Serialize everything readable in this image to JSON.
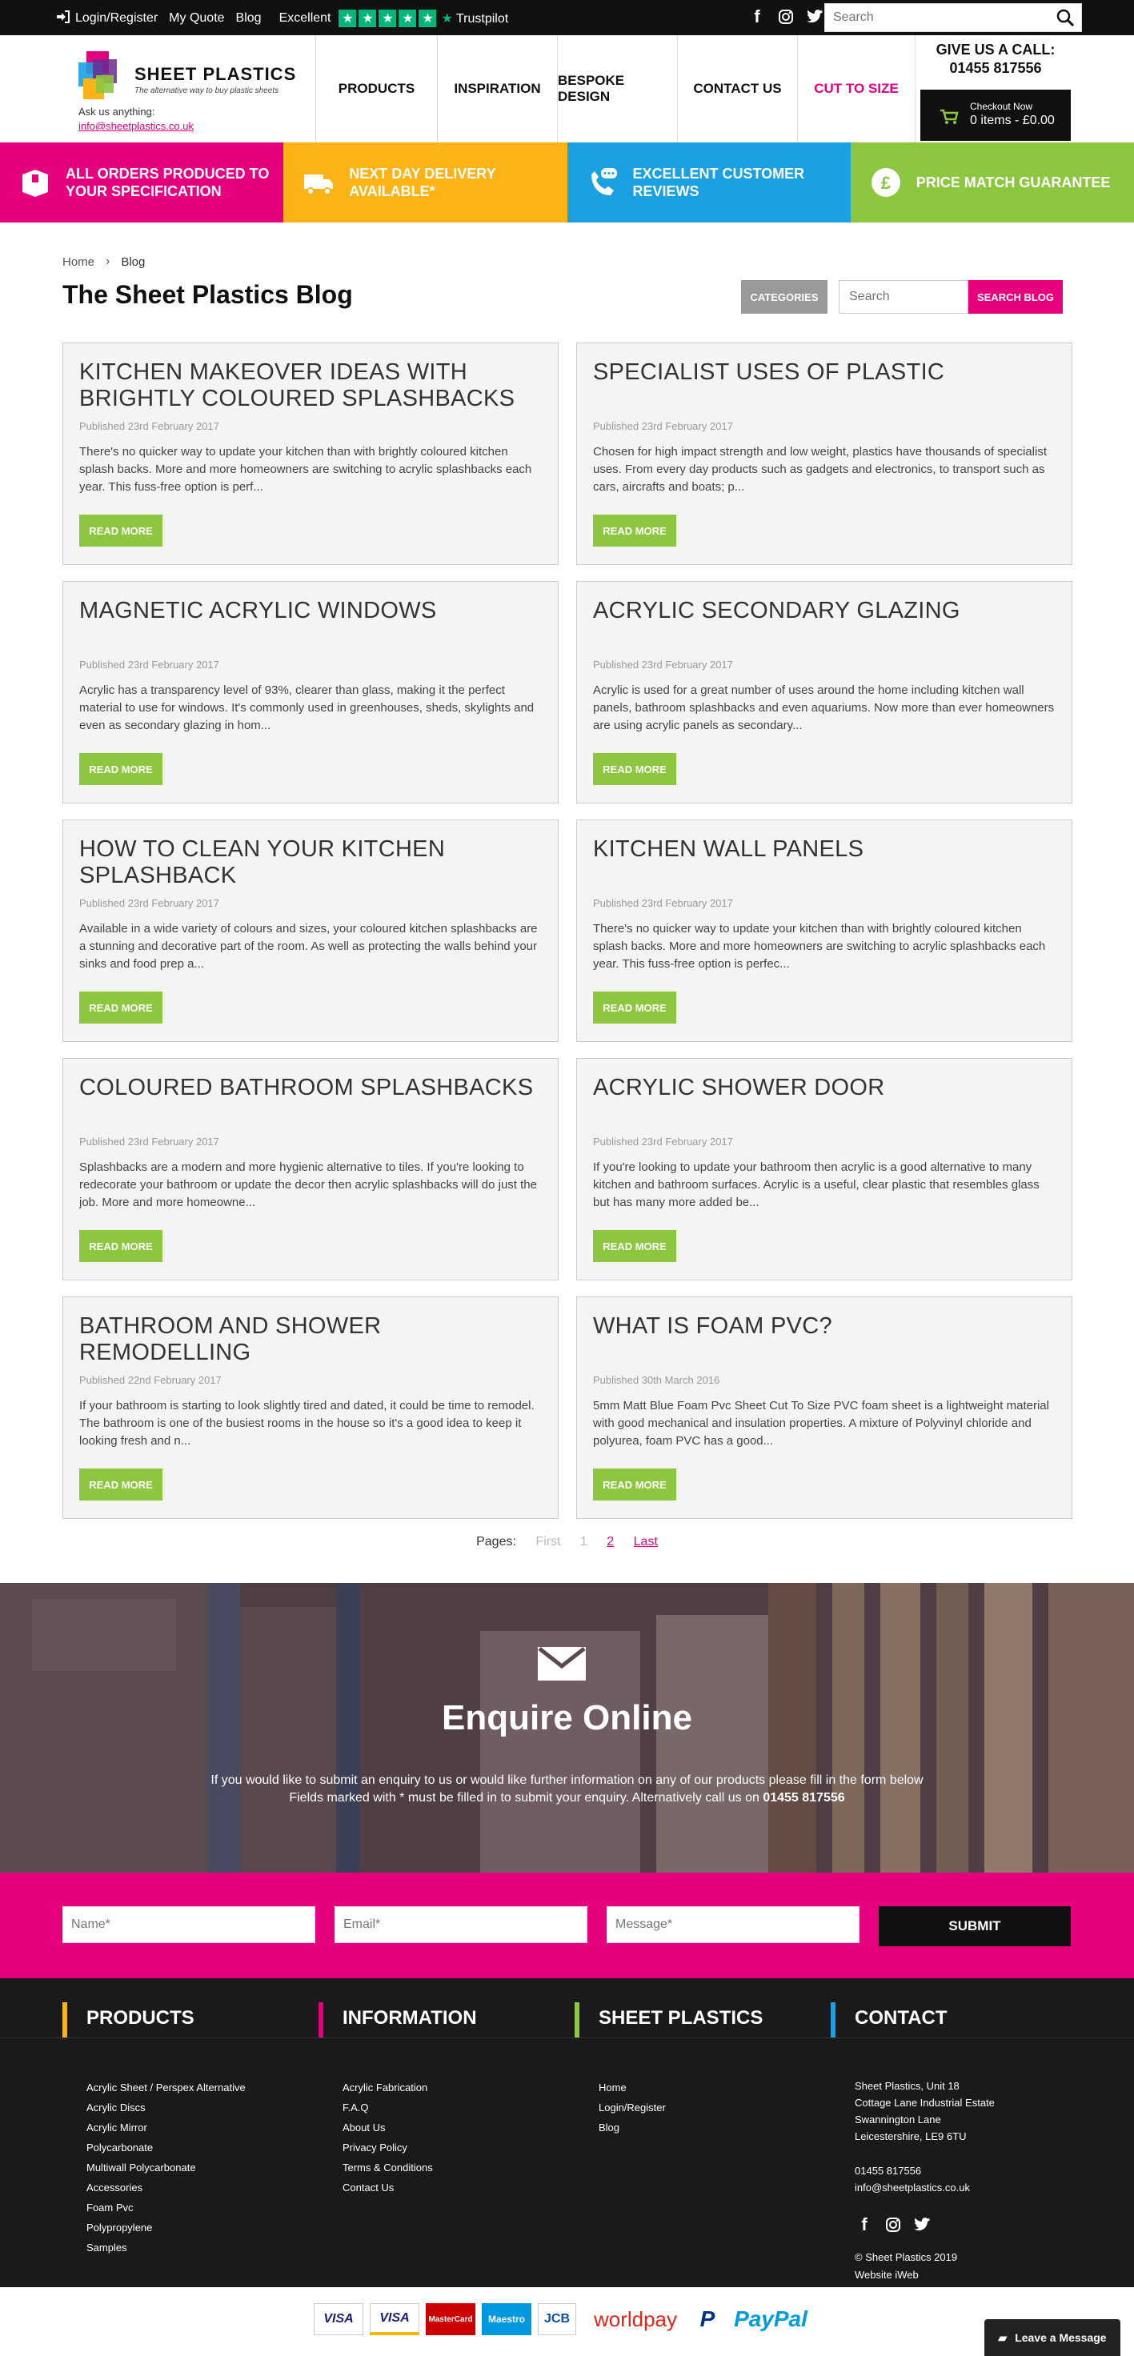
{
  "topbar": {
    "login_label": "Login/Register",
    "quote_label": "My Quote",
    "blog_label": "Blog",
    "rating_label": "Excellent",
    "trustpilot_label": "Trustpilot",
    "search_placeholder": "Search"
  },
  "header": {
    "brand_name": "SHEET PLASTICS",
    "brand_tagline": "The alternative way to buy plastic sheets",
    "ask_label": "Ask us anything:",
    "ask_email": "info@sheetplastics.co.uk",
    "nav": [
      {
        "label": "PRODUCTS"
      },
      {
        "label": "INSPIRATION"
      },
      {
        "label": "BESPOKE DESIGN"
      },
      {
        "label": "CONTACT US"
      },
      {
        "label": "CUT TO SIZE"
      }
    ],
    "call_label": "GIVE US A CALL:",
    "call_number": "01455 817556",
    "checkout_label": "Checkout Now",
    "checkout_summary": "0 items - £0.00"
  },
  "usp": [
    {
      "label": "ALL ORDERS PRODUCED TO YOUR SPECIFICATION",
      "color": "#e6007e",
      "icon": "box-icon"
    },
    {
      "label": "NEXT DAY DELIVERY AVAILABLE*",
      "color": "#fbb316",
      "icon": "truck-icon"
    },
    {
      "label": "EXCELLENT CUSTOMER REVIEWS",
      "color": "#1ba1e2",
      "icon": "phone-chat-icon"
    },
    {
      "label": "PRICE MATCH GUARANTEE",
      "color": "#8dc63f",
      "icon": "pound-icon"
    }
  ],
  "breadcrumb": {
    "home": "Home",
    "current": "Blog"
  },
  "blog": {
    "title": "The Sheet Plastics Blog",
    "categories_label": "CATEGORIES",
    "search_placeholder": "Search",
    "search_button": "SEARCH BLOG",
    "read_more": "READ MORE"
  },
  "posts": [
    {
      "title": "KITCHEN MAKEOVER IDEAS WITH BRIGHTLY COLOURED SPLASHBACKS",
      "date": "Published 23rd February 2017",
      "excerpt": "There's no quicker way to update your kitchen than with brightly coloured kitchen splash backs. More and more homeowners are switching to acrylic splashbacks each year. This fuss-free option is perf..."
    },
    {
      "title": "SPECIALIST USES OF PLASTIC",
      "date": "Published 23rd February 2017",
      "excerpt": "Chosen for high impact strength and low weight, plastics have thousands of specialist uses. From every day products such as gadgets and electronics, to transport such as cars, aircrafts and boats; p..."
    },
    {
      "title": "MAGNETIC ACRYLIC WINDOWS",
      "date": "Published 23rd February 2017",
      "excerpt": "Acrylic has a transparency level of 93%, clearer than glass, making it the perfect material to use for windows. It's commonly used in greenhouses, sheds, skylights and even as secondary glazing in hom..."
    },
    {
      "title": "ACRYLIC SECONDARY GLAZING",
      "date": "Published 23rd February 2017",
      "excerpt": "Acrylic is used for a great number of uses around the home including kitchen wall panels, bathroom splashbacks and even aquariums. Now more than ever homeowners are using acrylic panels as secondary..."
    },
    {
      "title": "HOW TO CLEAN YOUR KITCHEN SPLASHBACK",
      "date": "Published 23rd February 2017",
      "excerpt": "Available in a wide variety of colours and sizes, your coloured kitchen splashbacks are a stunning and decorative part of the room. As well as protecting the walls behind your sinks and food prep a..."
    },
    {
      "title": "KITCHEN WALL PANELS",
      "date": "Published 23rd February 2017",
      "excerpt": "There's no quicker way to update your kitchen than with brightly coloured kitchen splash backs. More and more homeowners are switching to acrylic splashbacks each year. This fuss-free option is perfec..."
    },
    {
      "title": "COLOURED BATHROOM SPLASHBACKS",
      "date": "Published 23rd February 2017",
      "excerpt": "Splashbacks are a modern and more hygienic alternative to tiles. If you're looking to redecorate your bathroom or update the decor then acrylic splashbacks will do just the job. More and more homeowne..."
    },
    {
      "title": "ACRYLIC SHOWER DOOR",
      "date": "Published 23rd February 2017",
      "excerpt": "If you're looking to update your bathroom then acrylic is a good alternative to many kitchen and bathroom surfaces. Acrylic is a useful, clear plastic that resembles glass but has many more added be..."
    },
    {
      "title": "BATHROOM AND SHOWER REMODELLING",
      "date": "Published 22nd February 2017",
      "excerpt": "If your bathroom is starting to look slightly tired and dated, it could be time to remodel. The bathroom is one of the busiest rooms in the house so it's a good idea to keep it looking fresh and n..."
    },
    {
      "title": "WHAT IS FOAM PVC?",
      "date": "Published 30th March 2016",
      "excerpt": "5mm Matt Blue Foam Pvc Sheet Cut To Size PVC foam sheet is a lightweight material with good mechanical and insulation properties. A mixture of Polyvinyl chloride and polyurea, foam PVC has a good..."
    }
  ],
  "pager": {
    "label": "Pages:",
    "first": "First",
    "p1": "1",
    "p2": "2",
    "last": "Last"
  },
  "enquire": {
    "title": "Enquire Online",
    "text1": "If you would like to submit an enquiry to us or would like further information on any of our products please fill in the form below",
    "text2": "Fields marked with * must be filled in to submit your enquiry. Alternatively call us on",
    "phone": "01455 817556"
  },
  "form": {
    "name_placeholder": "Name*",
    "email_placeholder": "Email*",
    "message_placeholder": "Message*",
    "submit_label": "SUBMIT"
  },
  "footer": {
    "products": {
      "heading": "PRODUCTS",
      "color": "#fbb316",
      "items": [
        "Acrylic Sheet / Perspex Alternative",
        "Acrylic Discs",
        "Acrylic Mirror",
        "Polycarbonate",
        "Multiwall Polycarbonate",
        "Accessories",
        "Foam Pvc",
        "Polypropylene",
        "Samples"
      ]
    },
    "information": {
      "heading": "INFORMATION",
      "color": "#e6007e",
      "items": [
        "Acrylic Fabrication",
        "F.A.Q",
        "About Us",
        "Privacy Policy",
        "Terms & Conditions",
        "Contact Us"
      ]
    },
    "sheet_plastics": {
      "heading": "SHEET PLASTICS",
      "color": "#8dc63f",
      "items": [
        "Home",
        "Login/Register",
        "Blog"
      ]
    },
    "contact": {
      "heading": "CONTACT",
      "color": "#1ba1e2",
      "address": [
        "Sheet Plastics, Unit 18",
        "Cottage Lane Industrial Estate",
        "Swannington Lane",
        "Leicestershire, LE9 6TU"
      ],
      "phone": "01455 817556",
      "email": "info@sheetplastics.co.uk",
      "copyright": "© Sheet Plastics 2019",
      "credit": "Website iWeb"
    }
  },
  "payments": [
    "VISA",
    "VISA",
    "MasterCard",
    "Maestro",
    "JCB",
    "worldpay",
    "PayPal"
  ],
  "chat": {
    "label": "Leave a Message"
  }
}
